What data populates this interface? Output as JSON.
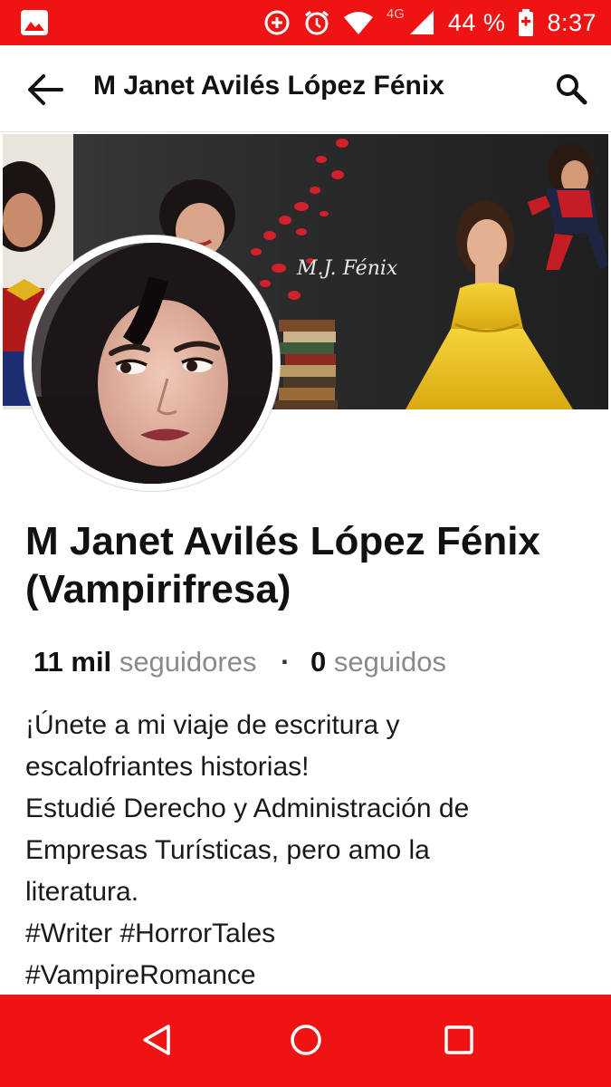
{
  "status_bar": {
    "network": "4G",
    "battery": "44 %",
    "time": "8:37",
    "icons": [
      "image-icon",
      "data-saver-icon",
      "alarm-icon",
      "wifi-icon",
      "signal-icon",
      "battery-charging-icon"
    ]
  },
  "app_bar": {
    "title": "M Janet Avilés López Fénix",
    "back_icon": "arrow-left-icon",
    "search_icon": "search-icon"
  },
  "cover": {
    "signature": "M.J. Fénix"
  },
  "profile": {
    "name_line1": "M Janet Avilés López Fénix",
    "name_line2": "(Vampirifresa)",
    "followers_count": "11 mil",
    "followers_label": "seguidores",
    "separator": "·",
    "following_count": "0",
    "following_label": "seguidos",
    "bio_lines": [
      "¡Únete a mi viaje de escritura y",
      "escalofriantes historias!",
      "Estudié Derecho y Administración de",
      "Empresas Turísticas, pero amo la",
      "literatura.",
      "#Writer #HorrorTales",
      "#VampireRomance"
    ]
  },
  "nav_bar": {
    "icons": [
      "back-triangle-icon",
      "home-circle-icon",
      "recents-square-icon"
    ]
  },
  "colors": {
    "accent": "#f01313",
    "muted_text": "#8a8a8a"
  }
}
